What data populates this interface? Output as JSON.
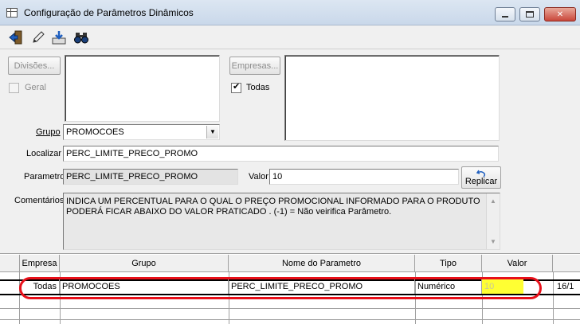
{
  "window": {
    "title": "Configuração de Parâmetros Dinâmicos",
    "icon": "table-icon",
    "controls": [
      "minimize-icon",
      "maximize-icon",
      "close-icon"
    ]
  },
  "toolbar": {
    "buttons": [
      {
        "icon": "exit-door-icon",
        "tooltip": ""
      },
      {
        "icon": "pencil-edit-icon",
        "tooltip": ""
      },
      {
        "icon": "save-download-icon",
        "tooltip": ""
      },
      {
        "icon": "binoculars-search-icon",
        "tooltip": ""
      }
    ]
  },
  "divisoes": {
    "button_label": "Divisões...",
    "geral_label": "Geral",
    "geral_checked": false,
    "enabled": false
  },
  "empresas": {
    "button_label": "Empresas...",
    "todas_label": "Todas",
    "todas_checked": true,
    "enabled": false
  },
  "form": {
    "grupo_label": "Grupo",
    "grupo_value": "PROMOCOES",
    "localizar_label": "Localizar",
    "localizar_value": "PERC_LIMITE_PRECO_PROMO",
    "parametro_label": "Parametro",
    "parametro_value": "PERC_LIMITE_PRECO_PROMO",
    "valor_label": "Valor",
    "valor_value": "10",
    "replicar_label": "Replicar",
    "comentarios_label": "Comentários",
    "comentarios_value": "INDICA UM PERCENTUAL PARA O QUAL O PREÇO PROMOCIONAL INFORMADO PARA O PRODUTO PODERÁ FICAR ABAIXO DO VALOR PRATICADO . (-1) = Não veirifica Parâmetro."
  },
  "grid": {
    "columns": [
      "Empresa",
      "Grupo",
      "Nome do Parametro",
      "Tipo",
      "Valor",
      ""
    ],
    "rows": [
      {
        "empresa": "Todas",
        "grupo": "PROMOCOES",
        "nome": "PERC_LIMITE_PRECO_PROMO",
        "tipo": "Numérico",
        "valor": "10",
        "extra": "16/1"
      }
    ]
  },
  "colors": {
    "highlight_ring": "#e8101a",
    "valor_cell_bg": "#ffff33"
  }
}
